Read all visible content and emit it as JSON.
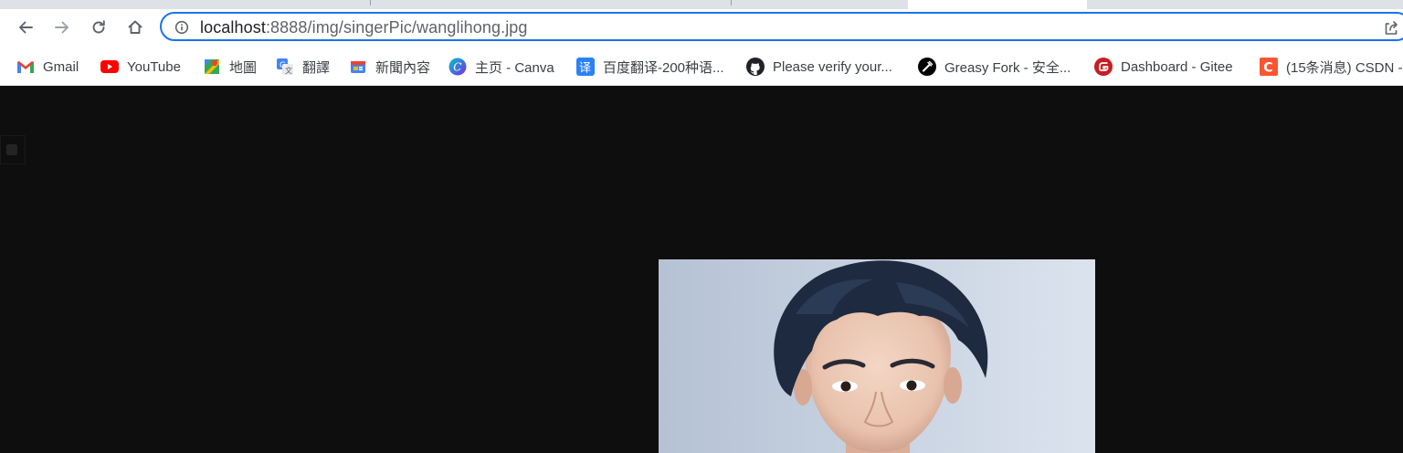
{
  "browser": {
    "address_bar": {
      "host": "localhost",
      "path": ":8888/img/singerPic/wanglihong.jpg"
    },
    "icons": {
      "back": "arrow-left-icon",
      "forward": "arrow-right-icon",
      "reload": "reload-icon",
      "home": "home-icon",
      "site_info": "info-icon",
      "share": "share-icon"
    },
    "accent_color": "#1a73e8"
  },
  "bookmarks": [
    {
      "label": "Gmail",
      "icon": "gmail-icon"
    },
    {
      "label": "YouTube",
      "icon": "youtube-icon"
    },
    {
      "label": "地圖",
      "icon": "maps-icon"
    },
    {
      "label": "翻譯",
      "icon": "translate-icon"
    },
    {
      "label": "新聞內容",
      "icon": "news-icon"
    },
    {
      "label": "主页 - Canva",
      "icon": "canva-icon"
    },
    {
      "label": "百度翻译-200种语...",
      "icon": "baidu-translate-icon"
    },
    {
      "label": "Please verify your...",
      "icon": "github-icon"
    },
    {
      "label": "Greasy Fork - 安全...",
      "icon": "greasyfork-icon"
    },
    {
      "label": "Dashboard - Gitee",
      "icon": "gitee-icon"
    },
    {
      "label": "(15条消息) CSDN -",
      "icon": "csdn-icon"
    }
  ],
  "page": {
    "background": "#0e0e0e",
    "image": {
      "subject": "portrait-photo"
    }
  }
}
